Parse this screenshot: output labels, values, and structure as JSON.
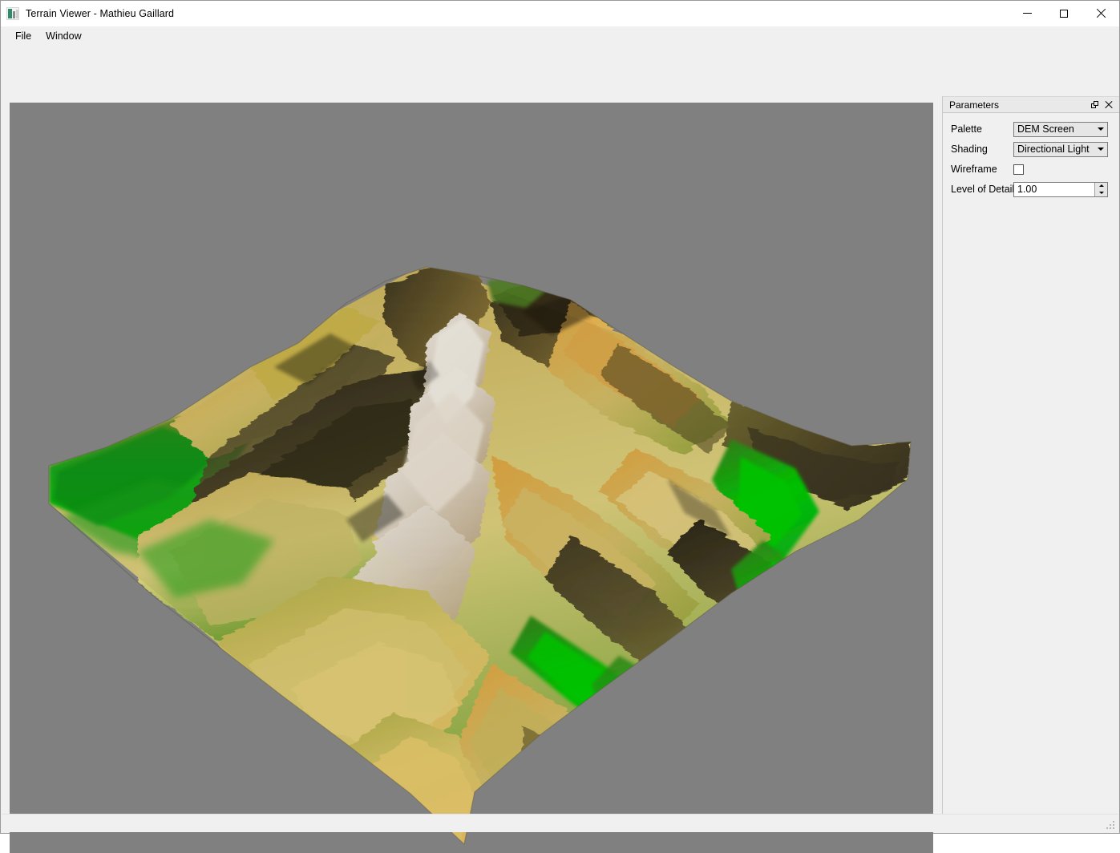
{
  "window": {
    "title": "Terrain Viewer - Mathieu Gaillard",
    "app_icon": "terrain-app-icon",
    "controls": {
      "minimize": "minimize-icon",
      "maximize": "maximize-icon",
      "close": "close-icon"
    }
  },
  "menubar": {
    "items": [
      {
        "label": "File"
      },
      {
        "label": "Window"
      }
    ]
  },
  "viewport": {
    "name": "terrain-3d-viewport",
    "background_color": "#808080",
    "scene": "3d-heightmap-terrain"
  },
  "panel": {
    "title": "Parameters",
    "float_icon": "float-panel-icon",
    "close_icon": "close-panel-icon",
    "fields": {
      "palette": {
        "label": "Palette",
        "value": "DEM Screen",
        "options": [
          "DEM Screen"
        ]
      },
      "shading": {
        "label": "Shading",
        "value": "Directional Light",
        "options": [
          "Directional Light"
        ]
      },
      "wireframe": {
        "label": "Wireframe",
        "checked": false
      },
      "level_of_details": {
        "label": "Level of Details",
        "value": "1.00"
      }
    }
  },
  "palette_colors": {
    "low_green": "#00c000",
    "mid_yellow": "#d8c86a",
    "high_tan": "#caa85a",
    "peak_white": "#f2ece2",
    "shadow_dark": "#3a3323"
  }
}
